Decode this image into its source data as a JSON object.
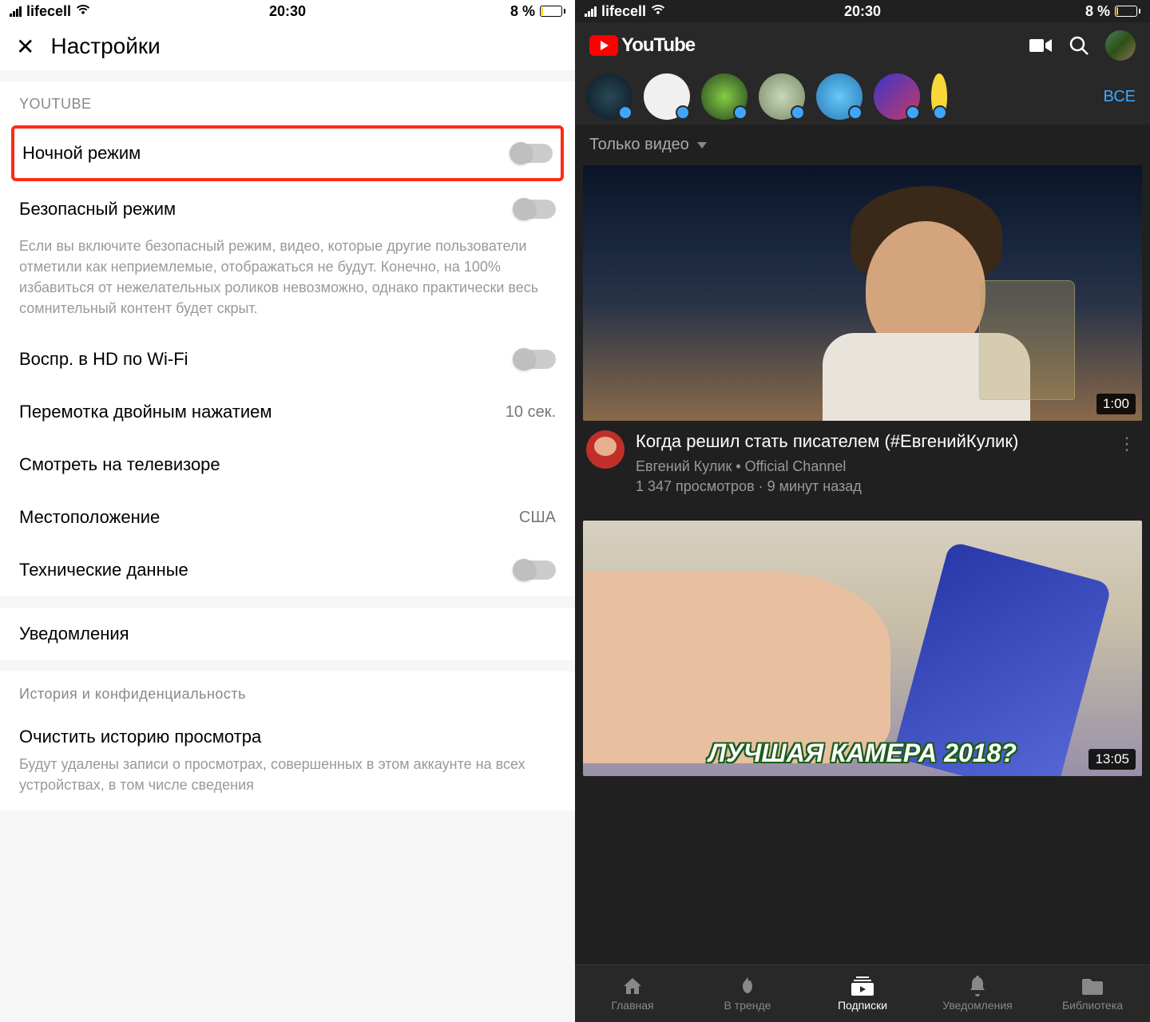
{
  "status": {
    "carrier": "lifecell",
    "time": "20:30",
    "battery_pct": "8 %"
  },
  "left": {
    "header_title": "Настройки",
    "section_youtube": "YOUTUBE",
    "night_mode": "Ночной режим",
    "safe_mode": "Безопасный режим",
    "safe_mode_desc": "Если вы включите безопасный режим, видео, которые другие пользователи отметили как неприемлемые, отображаться не будут. Конечно, на 100% избавиться от нежелательных роликов невозможно, однако практически весь сомнительный контент будет скрыт.",
    "hd_wifi": "Воспр. в HD по Wi-Fi",
    "double_tap": "Перемотка двойным нажатием",
    "double_tap_value": "10 сек.",
    "watch_tv": "Смотреть на телевизоре",
    "location": "Местоположение",
    "location_value": "США",
    "tech_data": "Технические данные",
    "notifications": "Уведомления",
    "history_section": "История и конфиденциальность",
    "clear_history": "Очистить историю просмотра",
    "clear_history_desc": "Будут удалены записи о просмотрах, совершенных в этом аккаунте на всех устройствах, в том числе сведения"
  },
  "right": {
    "logo_text": "YouTube",
    "all_link": "ВСЕ",
    "filter": "Только видео",
    "video1": {
      "duration": "1:00",
      "title": "Когда решил стать писателем (#ЕвгенийКулик)",
      "channel": "Евгений Кулик • Official Channel",
      "stats": "1 347 просмотров · 9 минут назад"
    },
    "video2": {
      "overlay": "ЛУЧШАЯ КАМЕРА 2018?",
      "duration": "13:05"
    },
    "tabs": {
      "home": "Главная",
      "trending": "В тренде",
      "subs": "Подписки",
      "notif": "Уведомления",
      "library": "Библиотека"
    }
  }
}
